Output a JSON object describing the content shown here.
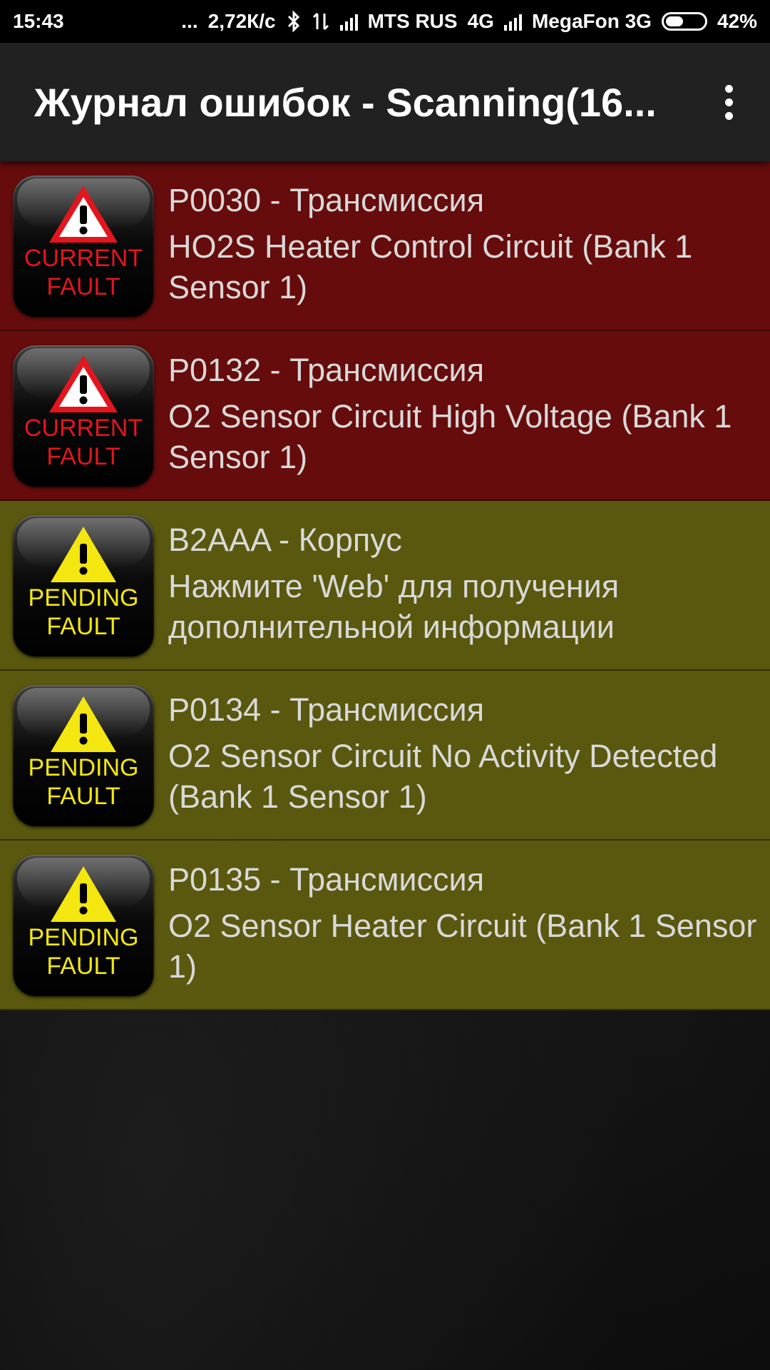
{
  "status_bar": {
    "time": "15:43",
    "dots": "...",
    "speed": "2,72К/с",
    "carrier1": "MTS RUS",
    "net1": "4G",
    "carrier2": "MegaFon 3G",
    "battery": "42%"
  },
  "app_bar": {
    "title": "Журнал ошибок - Scanning(16..."
  },
  "faults": [
    {
      "status": "current",
      "badge_line1": "CURRENT",
      "badge_line2": "FAULT",
      "code": "P0030 - Трансмиссия",
      "description": "HO2S Heater Control Circuit (Bank 1 Sensor 1)"
    },
    {
      "status": "current",
      "badge_line1": "CURRENT",
      "badge_line2": "FAULT",
      "code": "P0132 - Трансмиссия",
      "description": "O2 Sensor Circuit High Voltage (Bank 1 Sensor 1)"
    },
    {
      "status": "pending",
      "badge_line1": "PENDING",
      "badge_line2": "FAULT",
      "code": "B2AAA - Корпус",
      "description": "Нажмите 'Web' для получения дополнительной информации"
    },
    {
      "status": "pending",
      "badge_line1": "PENDING",
      "badge_line2": "FAULT",
      "code": "P0134 - Трансмиссия",
      "description": "O2 Sensor Circuit No Activity Detected (Bank 1 Sensor 1)"
    },
    {
      "status": "pending",
      "badge_line1": "PENDING",
      "badge_line2": "FAULT",
      "code": "P0135 - Трансмиссия",
      "description": "O2 Sensor Heater Circuit (Bank 1 Sensor 1)"
    }
  ],
  "colors": {
    "current_row": "#6e0c0c",
    "pending_row": "#605e0e",
    "current_badge_text": "#e3151d",
    "pending_badge_text": "#f3e70f",
    "app_bar": "#212121"
  },
  "icons": {
    "current_badge": "red-warning-triangle-icon",
    "pending_badge": "yellow-warning-triangle-icon",
    "overflow": "overflow-menu-icon",
    "bluetooth": "bluetooth-icon",
    "data_arrows": "data-transfer-icon",
    "signal": "signal-strength-icon",
    "battery": "battery-icon"
  }
}
